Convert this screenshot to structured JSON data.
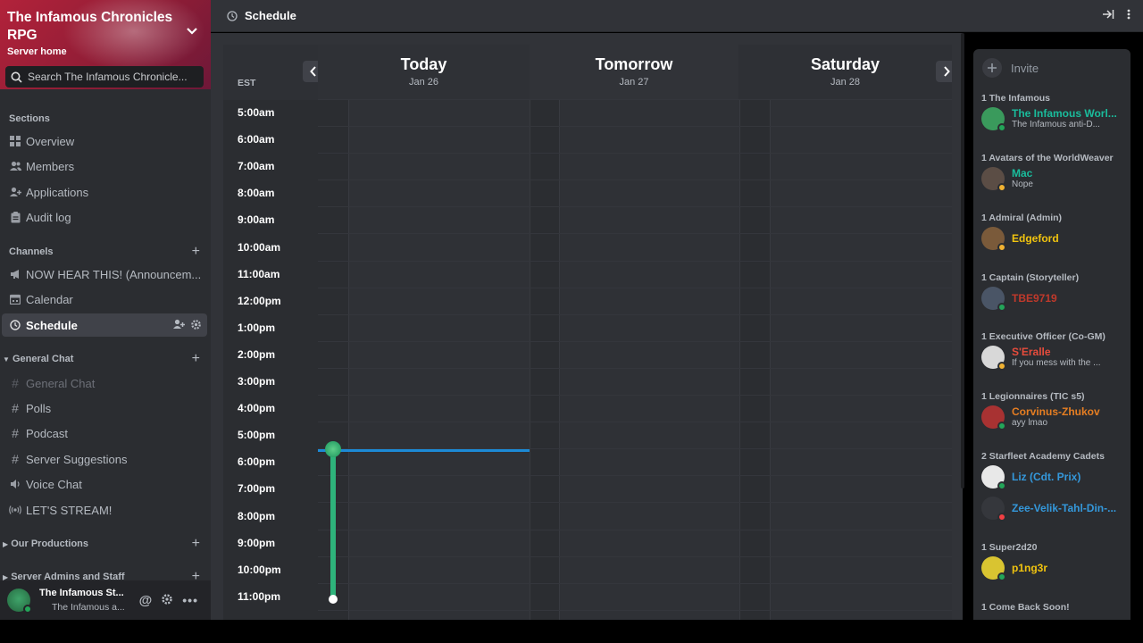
{
  "server": {
    "name": "The Infamous Chronicles RPG",
    "subtitle": "Server home",
    "search_placeholder": "Search The Infamous Chronicle..."
  },
  "sidebar": {
    "sections_header": "Sections",
    "sections": [
      {
        "label": "Overview",
        "icon": "grid-icon"
      },
      {
        "label": "Members",
        "icon": "members-icon"
      },
      {
        "label": "Applications",
        "icon": "user-plus-icon"
      },
      {
        "label": "Audit log",
        "icon": "clipboard-icon"
      }
    ],
    "channels_header": "Channels",
    "channels": [
      {
        "label": "NOW HEAR THIS! (Announcem...",
        "icon": "megaphone-icon"
      },
      {
        "label": "Calendar",
        "icon": "calendar-icon"
      },
      {
        "label": "Schedule",
        "icon": "clock-icon",
        "active": true
      }
    ],
    "general_header": "General Chat",
    "general": [
      {
        "label": "General Chat",
        "icon": "hash-icon",
        "muted": true
      },
      {
        "label": "Polls",
        "icon": "hash-icon"
      },
      {
        "label": "Podcast",
        "icon": "hash-icon"
      },
      {
        "label": "Server Suggestions",
        "icon": "hash-icon"
      },
      {
        "label": "Voice Chat",
        "icon": "speaker-icon"
      },
      {
        "label": "LET'S STREAM!",
        "icon": "broadcast-icon"
      }
    ],
    "productions_header": "Our Productions",
    "admins_header": "Server Admins and Staff"
  },
  "user": {
    "name": "The Infamous St...",
    "status": "The Infamous a..."
  },
  "header": {
    "title": "Schedule"
  },
  "schedule": {
    "timezone": "EST",
    "days": [
      {
        "name": "Today",
        "date": "Jan 26"
      },
      {
        "name": "Tomorrow",
        "date": "Jan 27"
      },
      {
        "name": "Saturday",
        "date": "Jan 28"
      }
    ],
    "times": [
      "5:00am",
      "6:00am",
      "7:00am",
      "8:00am",
      "9:00am",
      "10:00am",
      "11:00am",
      "12:00pm",
      "1:00pm",
      "2:00pm",
      "3:00pm",
      "4:00pm",
      "5:00pm",
      "6:00pm",
      "7:00pm",
      "8:00pm",
      "9:00pm",
      "10:00pm",
      "11:00pm"
    ],
    "current_time_hours": 17.55,
    "event": {
      "start_hours": 17.5,
      "end_hours": 23.0
    }
  },
  "members_panel": {
    "invite_label": "Invite",
    "groups": [
      {
        "role": "1 The Infamous",
        "members": [
          {
            "name": "The Infamous Worl...",
            "status": "The Infamous anti-D...",
            "color": "#1abc9c",
            "presence": "online",
            "avatar": "#3a9a5c"
          }
        ]
      },
      {
        "role": "1 Avatars of the WorldWeaver",
        "members": [
          {
            "name": "Mac",
            "status": "Nope",
            "color": "#1abc9c",
            "presence": "idle",
            "avatar": "#5b4d45"
          }
        ]
      },
      {
        "role": "1 Admiral (Admin)",
        "members": [
          {
            "name": "Edgeford",
            "color": "#f1c40f",
            "presence": "idle",
            "avatar": "#7a5a3a"
          }
        ]
      },
      {
        "role": "1 Captain (Storyteller)",
        "members": [
          {
            "name": "TBE9719",
            "color": "#c0392b",
            "presence": "online",
            "avatar": "#4a5566"
          }
        ]
      },
      {
        "role": "1 Executive Officer (Co-GM)",
        "members": [
          {
            "name": "S'Eralle",
            "status": "If you mess with the ...",
            "color": "#e74c3c",
            "presence": "idle",
            "avatar": "#d8d8d8"
          }
        ]
      },
      {
        "role": "1 Legionnaires (TIC s5)",
        "members": [
          {
            "name": "Corvinus-Zhukov",
            "status": "ayy lmao",
            "color": "#e67e22",
            "presence": "online",
            "avatar": "#a83232"
          }
        ]
      },
      {
        "role": "2 Starfleet Academy Cadets",
        "members": [
          {
            "name": "Liz (Cdt. Prix)",
            "color": "#3498db",
            "presence": "online",
            "avatar": "#e8e8e8"
          },
          {
            "name": "Zee-Velik-Tahl-Din-...",
            "color": "#3498db",
            "presence": "dnd",
            "avatar": "#35373c"
          }
        ]
      },
      {
        "role": "1 Super2d20",
        "members": [
          {
            "name": "p1ng3r",
            "color": "#f1c40f",
            "presence": "online",
            "avatar": "#d9c431"
          }
        ]
      },
      {
        "role": "1 Come Back Soon!",
        "members": []
      }
    ]
  },
  "colors": {
    "accent_blue": "#1c8ad6",
    "event_green": "#2eb37b",
    "online": "#23a559",
    "idle": "#f0b232",
    "dnd": "#f23f43"
  }
}
